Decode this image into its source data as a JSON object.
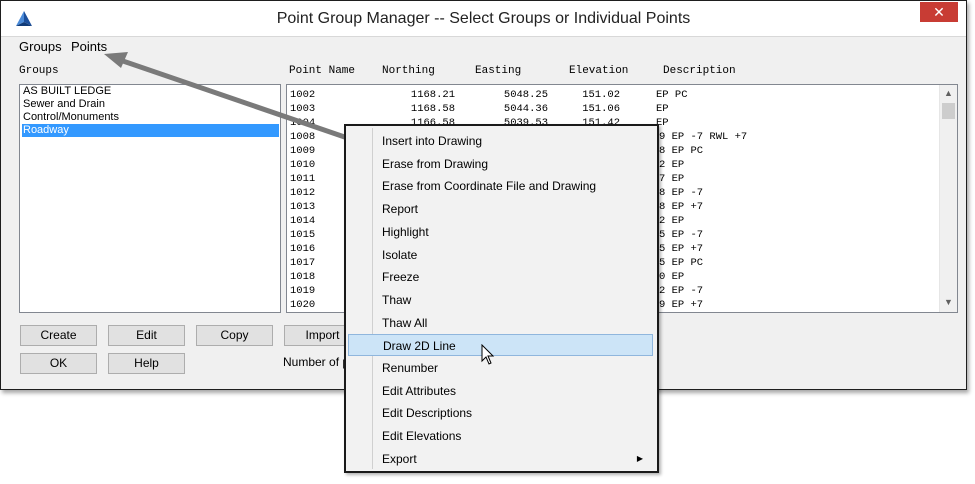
{
  "window": {
    "title": "Point Group Manager -- Select Groups or Individual Points",
    "close_glyph": "✕"
  },
  "menubar": {
    "groups": "Groups",
    "points": "Points"
  },
  "groups_panel": {
    "header": "Groups",
    "items": [
      "AS BUILT LEDGE",
      "Sewer and Drain",
      "Control/Monuments",
      "Roadway"
    ],
    "selected": "Roadway"
  },
  "points_panel": {
    "headers": [
      "Point Name",
      "Northing",
      "Easting",
      "Elevation",
      "Description"
    ],
    "rows": [
      [
        "1002",
        "1168.21",
        "5048.25",
        "151.02",
        "EP PC"
      ],
      [
        "1003",
        "1168.58",
        "5044.36",
        "151.06",
        "EP"
      ],
      [
        "1004",
        "1166.58",
        "5039.53",
        "151.42",
        "EP"
      ],
      [
        "1008",
        "",
        "",
        "",
        "9 EP -7 RWL +7"
      ],
      [
        "1009",
        "",
        "",
        "",
        "8 EP PC"
      ],
      [
        "1010",
        "",
        "",
        "",
        "2 EP"
      ],
      [
        "1011",
        "",
        "",
        "",
        "7 EP"
      ],
      [
        "1012",
        "",
        "",
        "",
        "8 EP -7"
      ],
      [
        "1013",
        "",
        "",
        "",
        "8 EP +7"
      ],
      [
        "1014",
        "",
        "",
        "",
        "2 EP"
      ],
      [
        "1015",
        "",
        "",
        "",
        "5 EP -7"
      ],
      [
        "1016",
        "",
        "",
        "",
        "5 EP +7"
      ],
      [
        "1017",
        "",
        "",
        "",
        "5 EP PC"
      ],
      [
        "1018",
        "",
        "",
        "",
        "0 EP"
      ],
      [
        "1019",
        "",
        "",
        "",
        "2 EP -7"
      ],
      [
        "1020",
        "",
        "",
        "",
        "9 EP +7"
      ]
    ]
  },
  "buttons": {
    "create": "Create",
    "edit": "Edit",
    "copy": "Copy",
    "import": "Import",
    "ok": "OK",
    "help": "Help"
  },
  "status_text": "Number of po",
  "context_menu": {
    "items": [
      "Insert into Drawing",
      "Erase from Drawing",
      "Erase from Coordinate File and Drawing",
      "Report",
      "Highlight",
      "Isolate",
      "Freeze",
      "Thaw",
      "Thaw All",
      "Draw 2D Line",
      "Renumber",
      "Edit Attributes",
      "Edit Descriptions",
      "Edit Elevations",
      "Export"
    ],
    "highlighted": "Draw 2D Line",
    "submenu_glyph": "▶"
  },
  "icons": {
    "app": "app-logo-icon",
    "cursor": "mouse-cursor-icon",
    "callout": "callout-arrow"
  },
  "colors": {
    "selection": "#3399ff",
    "menu_highlight": "#cce4f7",
    "close": "#c83c34",
    "callout_arrow": "#7a7a7a"
  }
}
